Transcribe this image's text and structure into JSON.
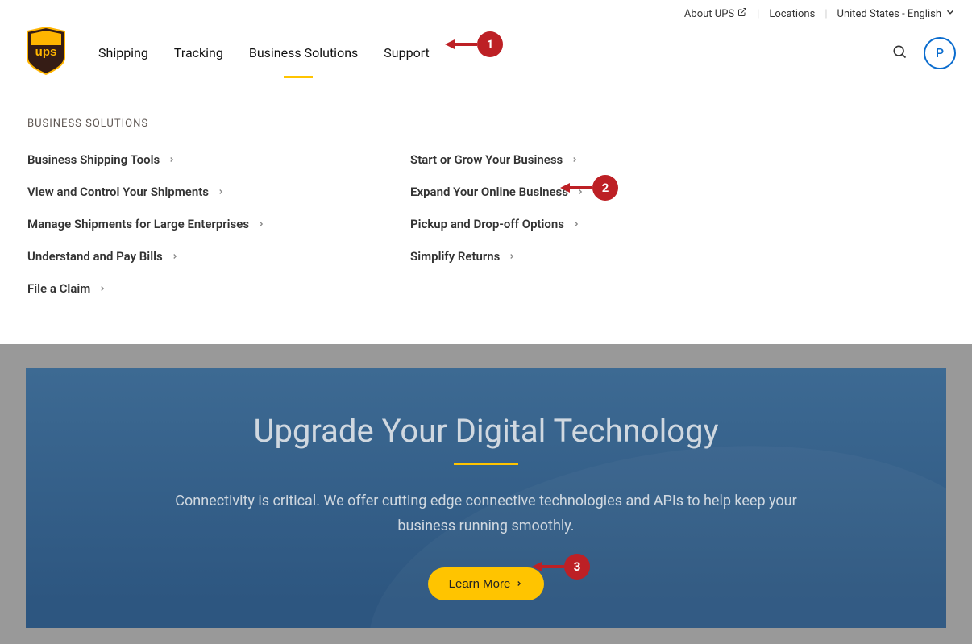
{
  "topbar": {
    "about": "About UPS",
    "locations": "Locations",
    "locale": "United States - English"
  },
  "nav": {
    "links": [
      "Shipping",
      "Tracking",
      "Business Solutions",
      "Support"
    ],
    "active_index": 2
  },
  "profile": {
    "initial": "P"
  },
  "dropdown": {
    "heading": "BUSINESS SOLUTIONS",
    "col1": [
      "Business Shipping Tools",
      "View and Control Your Shipments",
      "Manage Shipments for Large Enterprises",
      "Understand and Pay Bills",
      "File a Claim"
    ],
    "col2": [
      "Start or Grow Your Business",
      "Expand Your Online Business",
      "Pickup and Drop-off Options",
      "Simplify Returns"
    ]
  },
  "hero": {
    "title": "Upgrade Your Digital Technology",
    "text": "Connectivity is critical. We offer cutting edge connective technologies and APIs to help keep your business running smoothly.",
    "button": "Learn More"
  },
  "annotations": {
    "a1": "1",
    "a2": "2",
    "a3": "3"
  }
}
